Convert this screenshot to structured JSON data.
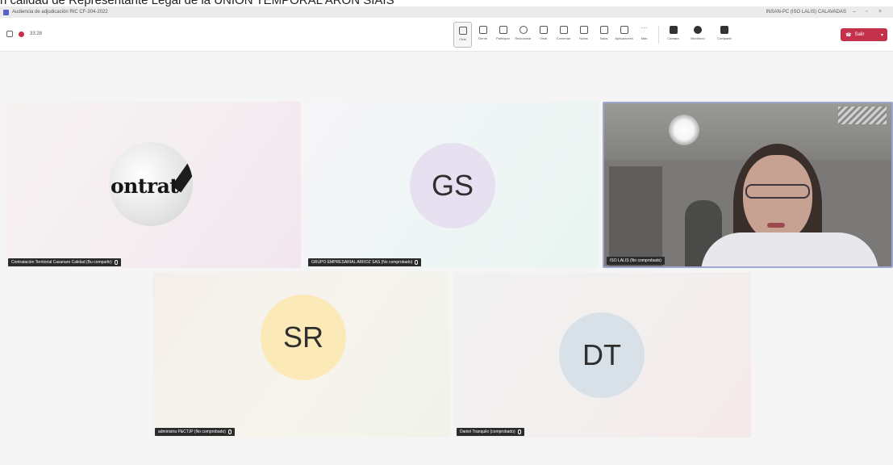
{
  "caption": "n calidad de Representante Legal de la UNIÓN TEMPORAL ARON SIAIS",
  "window": {
    "title": "Audiencia de adjudicación RIC CF-304-2022",
    "account": "INSAN-PC (ISO LALIS) CALAVADAS"
  },
  "meeting": {
    "timer": "33:28",
    "tools": [
      {
        "label": "Chat",
        "icon": "chat-icon"
      },
      {
        "label": "Gente",
        "icon": "people-icon"
      },
      {
        "label": "Participar",
        "icon": "raise-hand-icon"
      },
      {
        "label": "Reaccionar",
        "icon": "react-icon"
      },
      {
        "label": "Vista",
        "icon": "view-icon"
      },
      {
        "label": "Comentar",
        "icon": "comment-icon"
      },
      {
        "label": "Notas",
        "icon": "notes-icon"
      },
      {
        "label": "Salas",
        "icon": "rooms-icon"
      },
      {
        "label": "Aplicaciones",
        "icon": "apps-icon"
      },
      {
        "label": "Más",
        "icon": "more-icon"
      }
    ],
    "media": [
      {
        "label": "Cámara",
        "icon": "camera-icon"
      },
      {
        "label": "Micrófono",
        "icon": "microphone-icon"
      },
      {
        "label": "Compartir",
        "icon": "share-icon"
      }
    ],
    "leave_label": "Salir"
  },
  "participants": [
    {
      "name": "Contratación Territorial Casanare Calidad (Bu compartir)",
      "initials": "",
      "avatar_text": "ontrat"
    },
    {
      "name": "GRUPO EMPRESARIAL ARROZ SAS (No comprobado)",
      "initials": "GS"
    },
    {
      "name": "ISO LALIS (No comprobado)",
      "initials": ""
    },
    {
      "name": "administra P&CTJP (No comprobado)",
      "initials": "SR"
    },
    {
      "name": "Daniel Tranquilo (comprobado)",
      "initials": "DT"
    }
  ],
  "colors": {
    "leave": "#c4314b",
    "brand": "#5b5fc7",
    "gs_avatar": "#e7e0f0",
    "sr_avatar": "#fbe9b7",
    "dt_avatar": "#d9e1e8"
  }
}
